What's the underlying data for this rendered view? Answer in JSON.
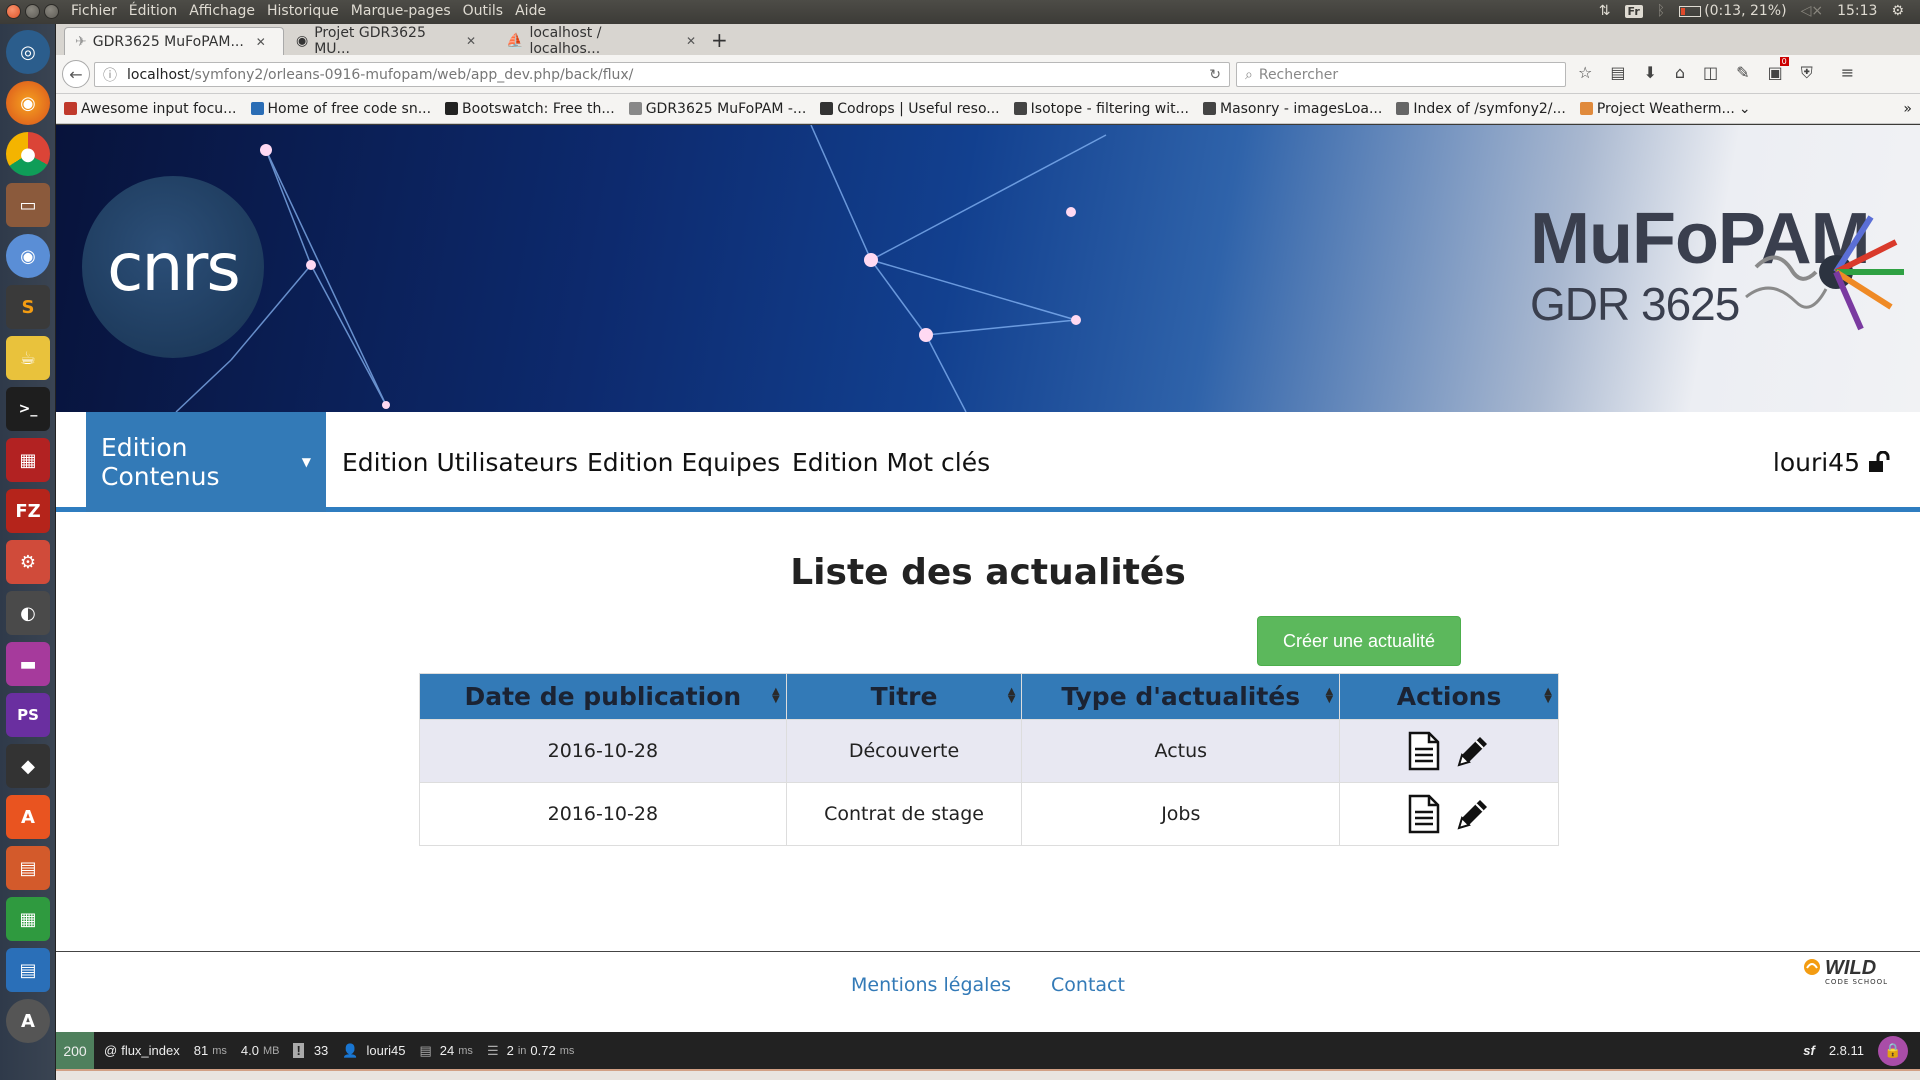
{
  "system": {
    "menu": [
      "Fichier",
      "Édition",
      "Affichage",
      "Historique",
      "Marque-pages",
      "Outils",
      "Aide"
    ],
    "keyboard": "Fr",
    "battery": "(0:13, 21%)",
    "clock": "15:13"
  },
  "browser": {
    "tabs": [
      {
        "title": "GDR3625 MuFoPAM..."
      },
      {
        "title": "Projet GDR3625 MU..."
      },
      {
        "title": "localhost / localhos..."
      }
    ],
    "url_host": "localhost",
    "url_path": "/symfony2/orleans-0916-mufopam/web/app_dev.php/back/flux/",
    "search_placeholder": "Rechercher",
    "notification_badge": "0",
    "bookmarks": [
      {
        "label": "Awesome input focu...",
        "color": "#c0392b"
      },
      {
        "label": "Home of free code sn...",
        "color": "#2a6db5"
      },
      {
        "label": "Bootswatch: Free th...",
        "color": "#222222"
      },
      {
        "label": "GDR3625 MuFoPAM -...",
        "color": "#888888"
      },
      {
        "label": "Codrops | Useful reso...",
        "color": "#333333"
      },
      {
        "label": "Isotope - filtering wit...",
        "color": "#444444"
      },
      {
        "label": "Masonry - imagesLoa...",
        "color": "#444444"
      },
      {
        "label": "Index of /symfony2/...",
        "color": "#666666"
      },
      {
        "label": "Project Weatherm...",
        "color": "#e08a3c"
      }
    ]
  },
  "banner": {
    "left_logo_text": "cnrs",
    "right_logo_title": "MuFoPAM",
    "right_logo_subtitle": "GDR 3625"
  },
  "nav": {
    "items": [
      {
        "label": "Edition Contenus"
      },
      {
        "label": "Edition Utilisateurs"
      },
      {
        "label": "Edition Equipes"
      },
      {
        "label": "Edition Mot clés"
      }
    ],
    "username": "louri45"
  },
  "main": {
    "title": "Liste des actualités",
    "create_button": "Créer une actualité",
    "table": {
      "headers": [
        "Date de publication",
        "Titre",
        "Type d'actualités",
        "Actions"
      ],
      "rows": [
        {
          "date": "2016-10-28",
          "title": "Découverte",
          "type": "Actus"
        },
        {
          "date": "2016-10-28",
          "title": "Contrat de stage",
          "type": "Jobs"
        }
      ]
    }
  },
  "footer": {
    "links": [
      "Mentions légales",
      "Contact"
    ],
    "brand": "WILD",
    "brand_sub": "CODE SCHOOL"
  },
  "debug": {
    "status": "200",
    "route": "flux_index",
    "time_value": "81",
    "time_unit": "ms",
    "memory_value": "4.0",
    "memory_unit": "MB",
    "logs": "33",
    "user": "louri45",
    "twig_value": "24",
    "twig_unit": "ms",
    "db_queries": "2",
    "db_in": "in",
    "db_time": "0.72",
    "db_unit": "ms",
    "version": "2.8.11"
  },
  "colors": {
    "primary": "#337ab7",
    "success": "#5cb85c",
    "debug_status": "#4f805d"
  }
}
